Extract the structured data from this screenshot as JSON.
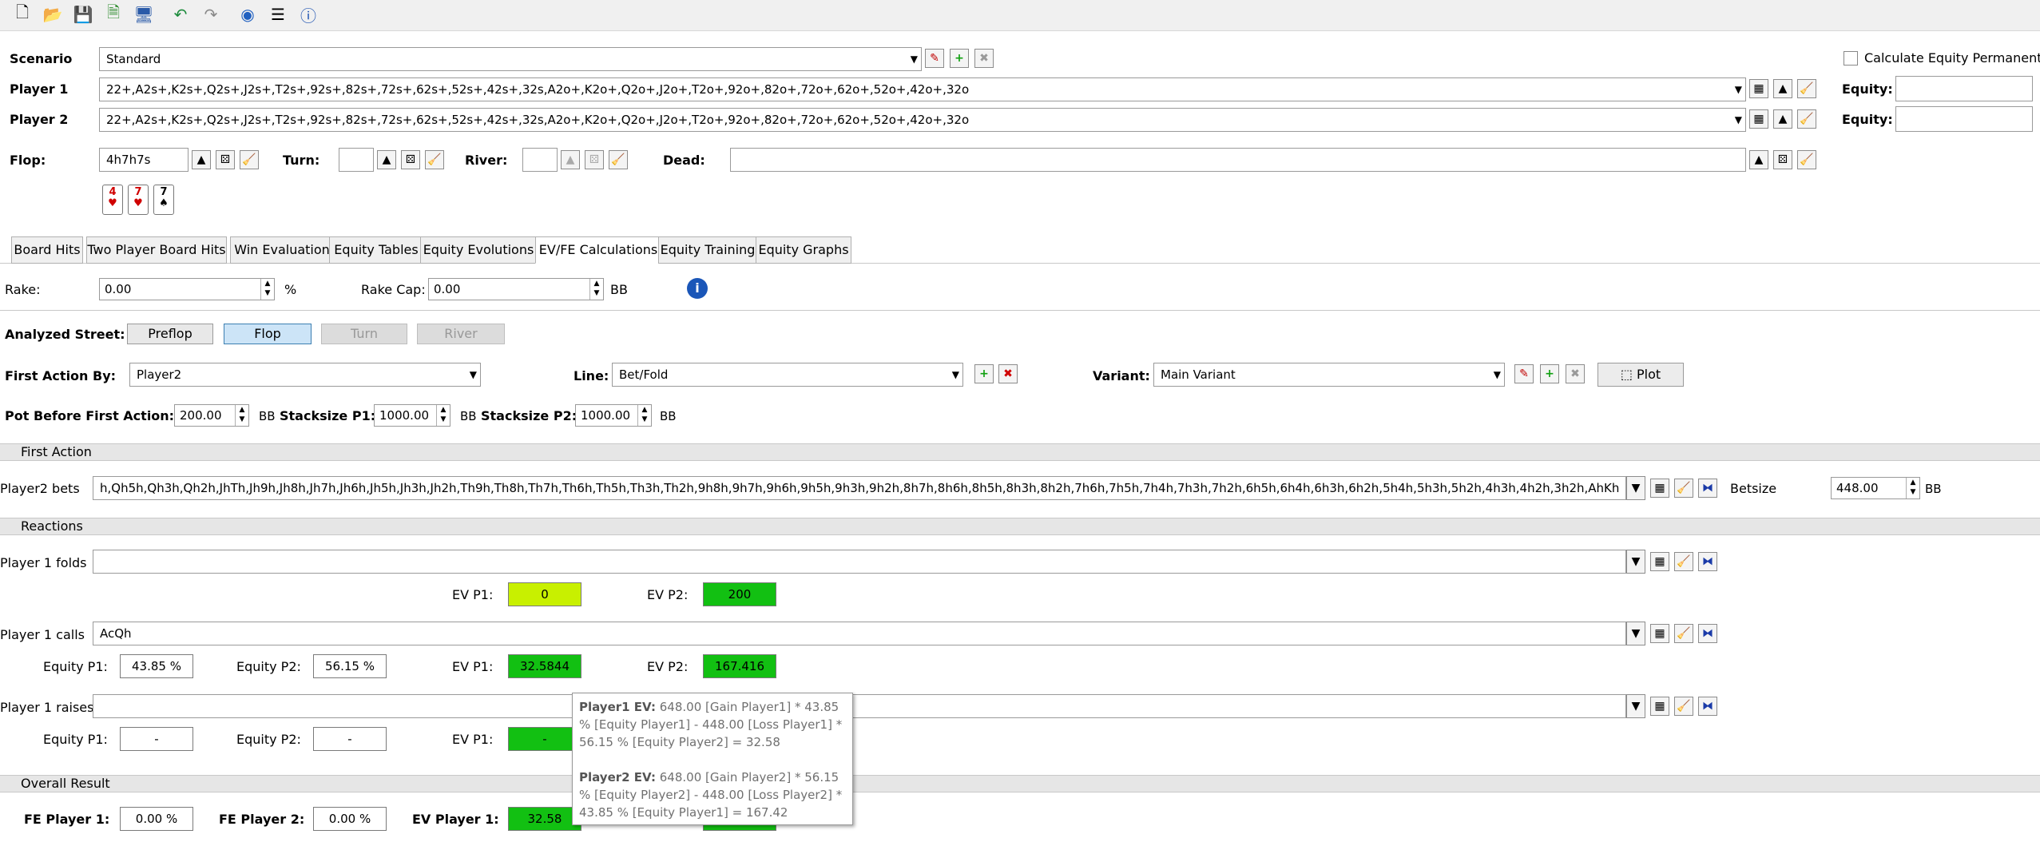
{
  "toolbar": {
    "icons": [
      "new-file-icon",
      "open-folder-icon",
      "save-icon",
      "export-icon",
      "monitor-icon",
      "undo-icon",
      "redo-icon",
      "refresh-icon",
      "list-icon",
      "info-icon"
    ]
  },
  "scenario": {
    "label": "Scenario",
    "value": "Standard"
  },
  "calc_equity_permanently": "Calculate Equity Permanently",
  "player1": {
    "label": "Player 1",
    "range": "22+,A2s+,K2s+,Q2s+,J2s+,T2s+,92s+,82s+,72s+,62s+,52s+,42s+,32s,A2o+,K2o+,Q2o+,J2o+,T2o+,92o+,82o+,72o+,62o+,52o+,42o+,32o",
    "equity_label": "Equity:"
  },
  "player2": {
    "label": "Player 2",
    "range": "22+,A2s+,K2s+,Q2s+,J2s+,T2s+,92s+,82s+,72s+,62s+,52s+,42s+,32s,A2o+,K2o+,Q2o+,J2o+,T2o+,92o+,82o+,72o+,62o+,52o+,42o+,32o",
    "equity_label": "Equity:"
  },
  "board": {
    "flop_label": "Flop:",
    "flop_value": "4h7h7s",
    "turn_label": "Turn:",
    "river_label": "River:",
    "dead_label": "Dead:"
  },
  "cards": [
    {
      "rank": "4",
      "suit": "♥",
      "color": "#d00000"
    },
    {
      "rank": "7",
      "suit": "♥",
      "color": "#d00000"
    },
    {
      "rank": "7",
      "suit": "♠",
      "color": "#000000"
    }
  ],
  "tabs": [
    "Board Hits",
    "Two Player Board Hits",
    "Win Evaluation",
    "Equity Tables",
    "Equity Evolutions",
    "EV/FE Calculations",
    "Equity Training",
    "Equity Graphs"
  ],
  "active_tab": "EV/FE Calculations",
  "rake": {
    "label": "Rake:",
    "value": "0.00",
    "unit": "%",
    "cap_label": "Rake Cap:",
    "cap_value": "0.00",
    "cap_unit": "BB"
  },
  "street": {
    "label": "Analyzed Street:",
    "buttons": [
      "Preflop",
      "Flop",
      "Turn",
      "River"
    ],
    "active": "Flop"
  },
  "first_action": {
    "label": "First Action By:",
    "value": "Player2"
  },
  "line": {
    "label": "Line:",
    "value": "Bet/Fold"
  },
  "variant": {
    "label": "Variant:",
    "value": "Main Variant",
    "plot": "Plot"
  },
  "pot": {
    "label": "Pot Before First Action:",
    "value": "200.00",
    "unit": "BB",
    "s1_label": "Stacksize P1:",
    "s1_value": "1000.00",
    "s1_unit": "BB",
    "s2_label": "Stacksize P2:",
    "s2_value": "1000.00",
    "s2_unit": "BB"
  },
  "sections": {
    "first": "First Action",
    "reactions": "Reactions",
    "overall": "Overall Result"
  },
  "p2bets": {
    "label": "Player2 bets",
    "range": "h,Qh5h,Qh3h,Qh2h,JhTh,Jh9h,Jh8h,Jh7h,Jh6h,Jh5h,Jh3h,Jh2h,Th9h,Th8h,Th7h,Th6h,Th5h,Th3h,Th2h,9h8h,9h7h,9h6h,9h5h,9h3h,9h2h,8h7h,8h6h,8h5h,8h3h,8h2h,7h6h,7h5h,7h4h,7h3h,7h2h,6h5h,6h4h,6h3h,6h2h,5h4h,5h3h,5h2h,4h3h,4h2h,3h2h,AhKh",
    "betsize_label": "Betsize",
    "betsize_value": "448.00",
    "betsize_unit": "BB"
  },
  "folds": {
    "label": "Player 1 folds",
    "range": "",
    "ev_p1_label": "EV P1:",
    "ev_p1": "0",
    "ev_p2_label": "EV P2:",
    "ev_p2": "200"
  },
  "calls": {
    "label": "Player 1 calls",
    "range": "AcQh",
    "eq_p1_label": "Equity P1:",
    "eq_p1": "43.85 %",
    "eq_p2_label": "Equity P2:",
    "eq_p2": "56.15 %",
    "ev_p1_label": "EV P1:",
    "ev_p1": "32.5844",
    "ev_p2_label": "EV P2:",
    "ev_p2": "167.416"
  },
  "raises": {
    "label": "Player 1 raises",
    "range": "",
    "eq_p1_label": "Equity P1:",
    "eq_p1": "-",
    "eq_p2_label": "Equity P2:",
    "eq_p2": "-",
    "ev_p1_label": "EV P1:",
    "ev_p1": "-"
  },
  "overall": {
    "fe1_label": "FE Player 1:",
    "fe1": "0.00 %",
    "fe2_label": "FE Player 2:",
    "fe2": "0.00 %",
    "ev1_label": "EV Player 1:",
    "ev1": "32.58"
  },
  "tooltip": {
    "p1_title": "Player1 EV:",
    "p1_line1": "648.00 [Gain Player1] * 43.85",
    "p1_line2": "% [Equity Player1] - 448.00 [Loss Player1] *",
    "p1_line3": "56.15 % [Equity Player2] = 32.58",
    "p2_title": "Player2 EV:",
    "p2_line1": "648.00 [Gain Player2] * 56.15",
    "p2_line2": "% [Equity Player2] - 448.00 [Loss Player2] *",
    "p2_line3": "43.85 % [Equity Player1] = 167.42"
  },
  "colors": {
    "ev_green": "#12c012",
    "ev_lime": "#c8f000",
    "flop_active": "#cce4f7"
  }
}
